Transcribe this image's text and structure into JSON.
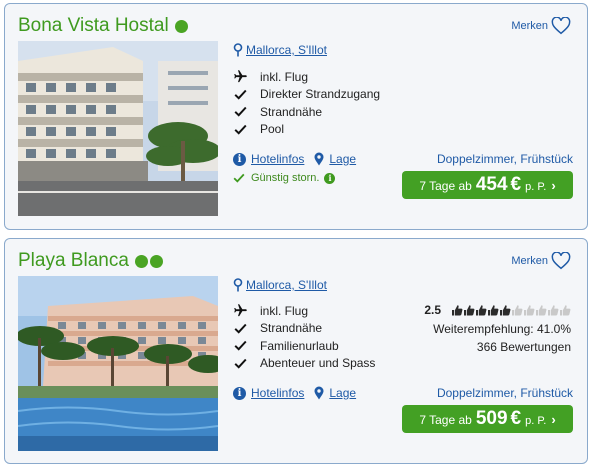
{
  "hotels": [
    {
      "name": "Bona Vista Hostal",
      "stars": 1,
      "merken_label": "Merken",
      "location": "Mallorca, S'Illot",
      "features": [
        "inkl. Flug",
        "Direkter Strandzugang",
        "Strandnähe",
        "Pool"
      ],
      "hotelinfos_label": "Hotelinfos",
      "lage_label": "Lage",
      "storno_label": "Günstig storn.",
      "room": "Doppelzimmer, Frühstück",
      "price_prefix": "7 Tage ab",
      "price": "454",
      "currency": "€",
      "per_person": "p. P."
    },
    {
      "name": "Playa Blanca",
      "stars": 2,
      "merken_label": "Merken",
      "location": "Mallorca, S'Illot",
      "features": [
        "inkl. Flug",
        "Strandnähe",
        "Familienurlaub",
        "Abenteuer und Spass"
      ],
      "hotelinfos_label": "Hotelinfos",
      "lage_label": "Lage",
      "rating_score": "2.5",
      "rating_fraction": 0.5,
      "recommendation": "Weiterempfehlung: 41.0%",
      "reviews": "366 Bewertungen",
      "room": "Doppelzimmer, Frühstück",
      "price_prefix": "7 Tage ab",
      "price": "509",
      "currency": "€",
      "per_person": "p. P."
    }
  ],
  "colors": {
    "title_green": "#3f9a1f",
    "button_green": "#43a024",
    "link_blue": "#1f5aa6",
    "card_bg": "#f4f6f9",
    "card_border": "#8aa9cc"
  }
}
